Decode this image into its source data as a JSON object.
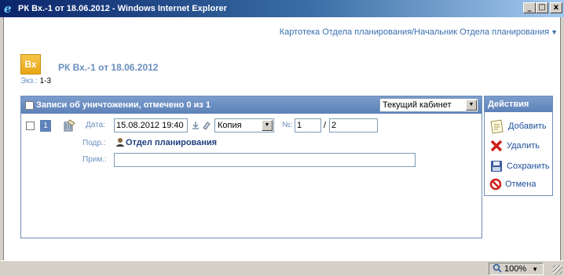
{
  "window": {
    "title": "РК Вх.-1 от 18.06.2012 - Windows Internet Explorer",
    "minimize": "_",
    "maximize": "□",
    "close": "x"
  },
  "breadcrumb": {
    "text": "Картотека Отдела планирования/Начальник Отдела планирования",
    "arrow": "▼"
  },
  "doc": {
    "badge": "Вх",
    "title": "РК Вх.-1 от 18.06.2012",
    "copies_label": "Экз.:",
    "copies_value": "1-3"
  },
  "records": {
    "header": "Записи об уничтожении, отмечено 0 из 1",
    "cabinet_select": "Текущий кабинет",
    "row": {
      "number": "1",
      "date_label": "Дата:",
      "date_value": "15.08.2012 19:40",
      "type_select": "Копия",
      "no_label": "№:",
      "no_value": "1",
      "no_separator": "/",
      "no_total": "2",
      "dept_label": "Подр.:",
      "dept_value": "Отдел планирования",
      "note_label": "Прим.:",
      "note_value": ""
    }
  },
  "actions": {
    "header": "Действия",
    "items": [
      {
        "label": "Добавить",
        "icon": "add-note-icon"
      },
      {
        "label": "Удалить",
        "icon": "delete-x-icon"
      },
      {
        "label": "Сохранить",
        "icon": "floppy-icon"
      },
      {
        "label": "Отмена",
        "icon": "cancel-icon"
      }
    ]
  },
  "status": {
    "zoom": "100%"
  }
}
